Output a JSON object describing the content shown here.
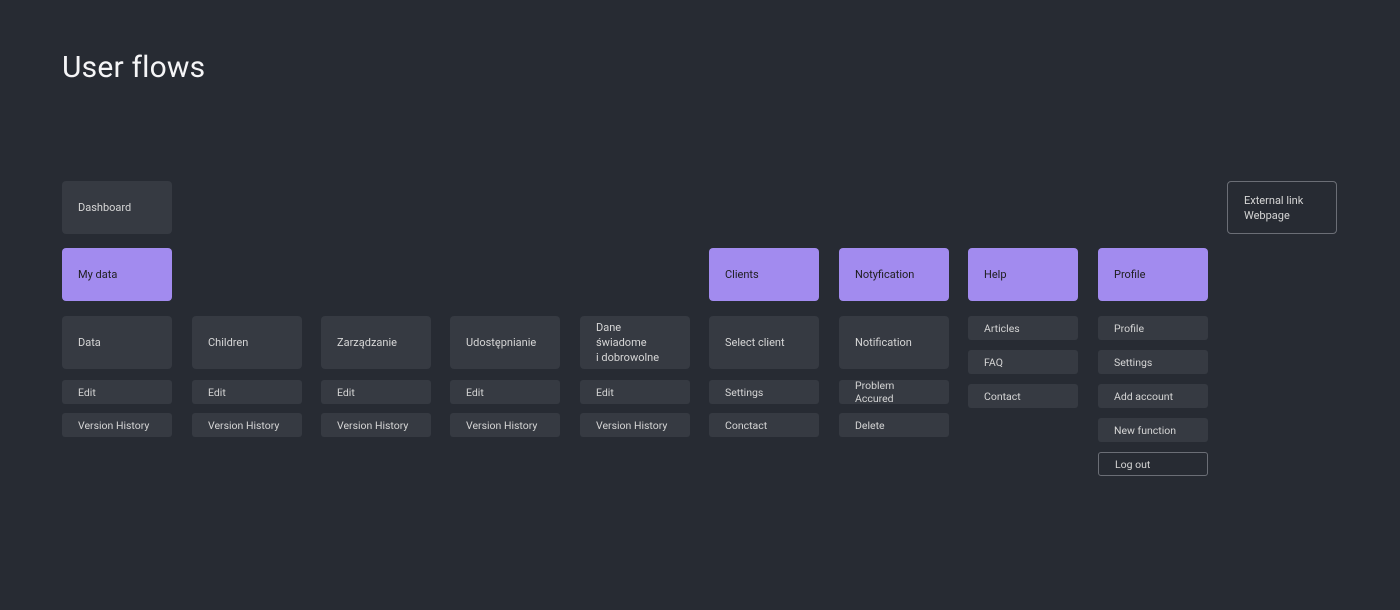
{
  "page": {
    "title": "User flows"
  },
  "external": {
    "line1": "External link",
    "line2": "Webpage"
  },
  "dashboard": "Dashboard",
  "sections": {
    "my_data": "My data",
    "clients": "Clients",
    "notification": "Notyfication",
    "help": "Help",
    "profile": "Profile"
  },
  "col0": {
    "top": "Data",
    "edit": "Edit",
    "ver": "Version History"
  },
  "col1": {
    "top": "Children",
    "edit": "Edit",
    "ver": "Version History"
  },
  "col2": {
    "top": "Zarządzanie",
    "edit": "Edit",
    "ver": "Version History"
  },
  "col3": {
    "top": "Udostępnianie",
    "edit": "Edit",
    "ver": "Version History"
  },
  "col4": {
    "top_l1": "Dane świadome",
    "top_l2": "i dobrowolne",
    "edit": "Edit",
    "ver": "Version History"
  },
  "col5": {
    "top": "Select client",
    "s1": "Settings",
    "s2": "Conctact"
  },
  "col6": {
    "top": "Notification",
    "s1": "Problem Accured",
    "s2": "Delete"
  },
  "col7": {
    "s0": "Articles",
    "s1": "FAQ",
    "s2": "Contact"
  },
  "col8": {
    "s0": "Profile",
    "s1": "Settings",
    "s2": "Add account",
    "s3": "New function",
    "s4": "Log out"
  }
}
